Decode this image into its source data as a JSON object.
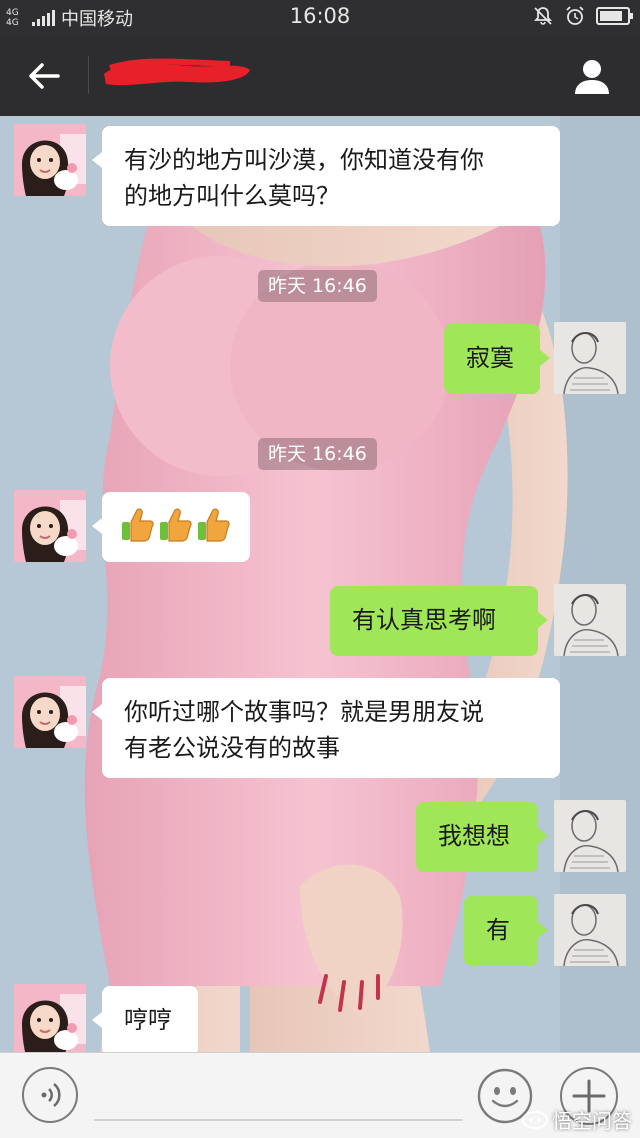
{
  "status_bar": {
    "network_badge": "4G 4G",
    "carrier": "中国移动",
    "time": "16:08",
    "battery_level": 0.85
  },
  "titlebar": {
    "contact_name_redacted": true
  },
  "messages": [
    {
      "side": "left",
      "text": "有沙的地方叫沙漠，你知道没有你的地方叫什么莫吗？",
      "line1": "有沙的地方叫沙漠，你知道没有你",
      "line2": "的地方叫什么莫吗？"
    },
    {
      "timestamp": "昨天 16:46"
    },
    {
      "side": "right",
      "text": "寂寞"
    },
    {
      "timestamp": "昨天 16:46"
    },
    {
      "side": "left",
      "emoji": "thumbs-up",
      "count": 3
    },
    {
      "side": "right",
      "text": "有认真思考啊"
    },
    {
      "side": "left",
      "text": "你听过哪个故事吗？就是男朋友说有老公说没有的故事",
      "line1": "你听过哪个故事吗？就是男朋友说",
      "line2": "有老公说没有的故事"
    },
    {
      "side": "right",
      "text": "我想想"
    },
    {
      "side": "right",
      "text": "有"
    },
    {
      "side": "left",
      "text": "哼哼"
    }
  ],
  "input_bar": {
    "placeholder": ""
  },
  "watermark": "悟空问答",
  "colors": {
    "right_bubble": "#9fe658",
    "left_bubble": "#ffffff",
    "titlebar": "#2d2d2f"
  }
}
